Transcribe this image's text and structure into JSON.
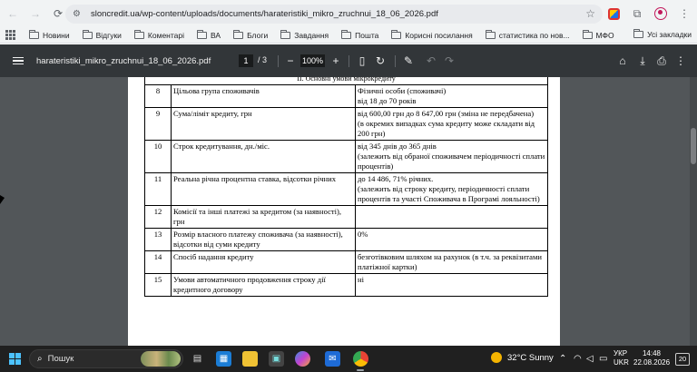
{
  "browser": {
    "url": "sloncredit.ua/wp-content/uploads/documents/harateristiki_mikro_zruchnui_18_06_2026.pdf",
    "bookmarks": [
      "Новини",
      "Відгуки",
      "Коментарі",
      "ВА",
      "Блоги",
      "Завдання",
      "Пошта",
      "Корисні посилання",
      "статистика по нов...",
      "МФО"
    ],
    "all_bookmarks": "Усі закладки"
  },
  "pdf_toolbar": {
    "title": "harateristiki_mikro_zruchnui_18_06_2026.pdf",
    "page_current": "1",
    "page_sep": "/",
    "page_total": "3",
    "zoom": "100%",
    "zoom_out": "−",
    "zoom_in": "+"
  },
  "document": {
    "section_header": "ІІ. Основні умови мікрокредиту",
    "rows": [
      {
        "num": "8",
        "name": "Цільова група споживачів",
        "value": "Фізичні особи (споживачі)\nвід 18 до 70 років"
      },
      {
        "num": "9",
        "name": "Сума/ліміт кредиту, грн",
        "value": " від 600,00 грн до 8 647,00 грн (зміна не передбачена)\n(в окремих випадках сума кредиту може складати від 200 грн)"
      },
      {
        "num": "10",
        "name": "Строк кредитування, дн./міс.",
        "value": "від 345 днів до 365 днів\n(залежить від обраної споживачем періодичності сплати процентів)"
      },
      {
        "num": "11",
        "name": "Реальна річна процентна ставка, відсотки річних",
        "value": "до 14 486, 71%  річних.\n(залежить від строку кредиту, періодичності сплати процентів та участі Споживача в Програмі лояльності)"
      },
      {
        "num": "12",
        "name": "Комісії та інші платежі за кредитом (за наявності), грн",
        "value": ""
      },
      {
        "num": "13",
        "name": "Розмір власного платежу споживача (за наявності), відсотки від суми кредиту",
        "value": "0%"
      },
      {
        "num": "14",
        "name": "Спосіб надання кредиту",
        "value": "безготівковим шляхом на рахунок (в т.ч. за реквізитами платіжної картки)"
      },
      {
        "num": "15",
        "name": "Умови автоматичного продовження строку дії кредитного договору",
        "value": "ні"
      }
    ]
  },
  "taskbar": {
    "search_placeholder": "Пошук",
    "weather": "32°C  Sunny",
    "lang_line1": "УКР",
    "lang_line2": "UKR",
    "time": "14:48",
    "date": "22.08.2026",
    "notification_count": "20"
  }
}
